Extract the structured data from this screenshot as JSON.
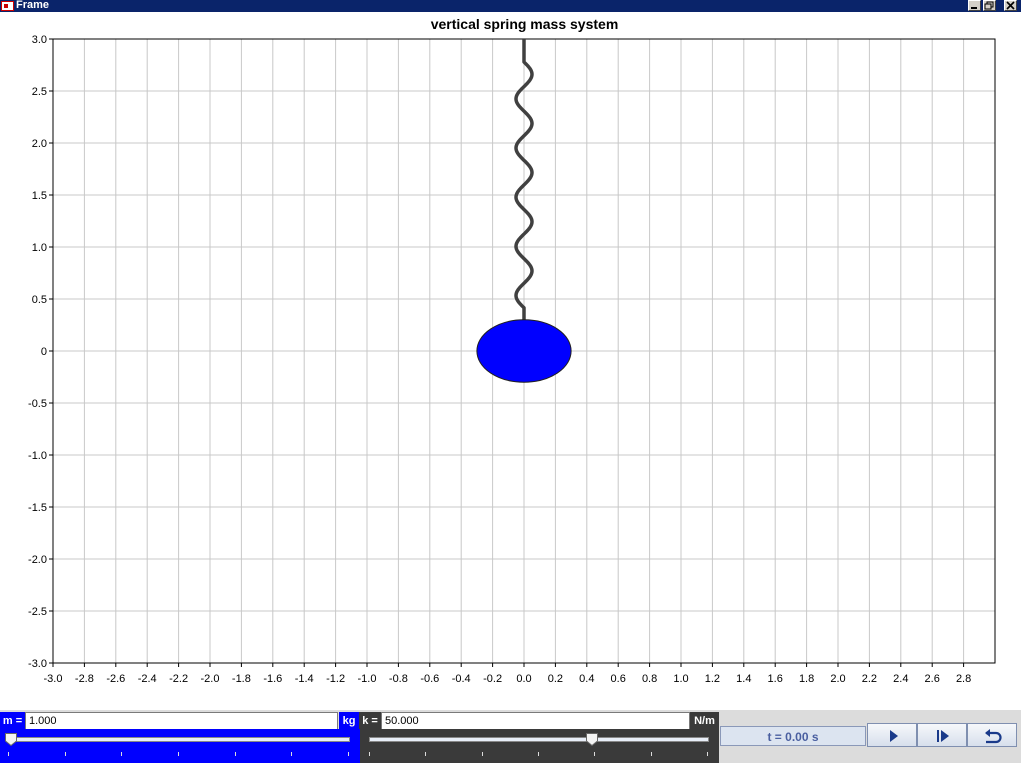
{
  "window": {
    "title": "Frame",
    "icon": "java-app-icon"
  },
  "window_controls": [
    "minimize-icon",
    "maximize-icon",
    "close-icon"
  ],
  "colors": {
    "mass": "#0000ff",
    "spring": "#404040",
    "mass_label_bg": "#0000ff",
    "k_label_bg": "#3a3a3a",
    "time_text": "#4a5fa0"
  },
  "chart_data": {
    "type": "scatter",
    "title": "vertical spring mass system",
    "xlabel": "",
    "ylabel": "",
    "xlim": [
      -3.0,
      3.0
    ],
    "ylim": [
      -3.0,
      3.0
    ],
    "grid": true,
    "x_ticks": [
      "-3.0",
      "-2.8",
      "-2.6",
      "-2.4",
      "-2.2",
      "-2.0",
      "-1.8",
      "-1.6",
      "-1.4",
      "-1.2",
      "-1.0",
      "-0.8",
      "-0.6",
      "-0.4",
      "-0.2",
      "0.0",
      "0.2",
      "0.4",
      "0.6",
      "0.8",
      "1.0",
      "1.2",
      "1.4",
      "1.6",
      "1.8",
      "2.0",
      "2.2",
      "2.4",
      "2.6",
      "2.8"
    ],
    "y_ticks": [
      "3.0",
      "2.5",
      "2.0",
      "1.5",
      "1.0",
      "0.5",
      "0",
      "-0.5",
      "-1.0",
      "-1.5",
      "-2.0",
      "-2.5",
      "-3.0"
    ],
    "spring": {
      "anchor": [
        0.0,
        3.0
      ],
      "end": [
        0.0,
        0.3
      ]
    },
    "mass": {
      "center": [
        0.0,
        0.0
      ],
      "radius": 0.3
    }
  },
  "controls": {
    "mass_label": "m =",
    "mass_value": "1.000",
    "mass_unit": "kg",
    "mass_slider_fraction": 0.0,
    "k_label": "k =",
    "k_value": "50.000",
    "k_unit": "N/m",
    "k_slider_fraction": 0.66,
    "time_text": "t = 0.00 s",
    "buttons": [
      "play-icon",
      "step-forward-icon",
      "reset-icon"
    ]
  }
}
